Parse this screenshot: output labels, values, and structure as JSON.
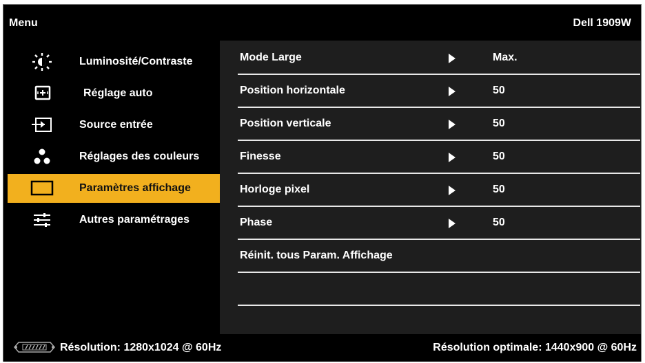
{
  "header": {
    "title": "Menu",
    "model": "Dell 1909W"
  },
  "sidebar": {
    "items": [
      {
        "label": "Luminosité/Contraste",
        "icon": "brightness-icon"
      },
      {
        "label": "Réglage auto",
        "icon": "auto-adjust-icon"
      },
      {
        "label": "Source entrée",
        "icon": "input-source-icon"
      },
      {
        "label": "Réglages des couleurs",
        "icon": "color-settings-icon"
      },
      {
        "label": "Paramètres affichage",
        "icon": "display-settings-icon",
        "selected": true
      },
      {
        "label": "Autres paramétrages",
        "icon": "other-settings-icon"
      }
    ]
  },
  "main": {
    "rows": [
      {
        "label": "Mode Large",
        "value": "Max."
      },
      {
        "label": "Position horizontale",
        "value": "50"
      },
      {
        "label": "Position verticale",
        "value": "50"
      },
      {
        "label": "Finesse",
        "value": "50"
      },
      {
        "label": "Horloge pixel",
        "value": "50"
      },
      {
        "label": "Phase",
        "value": "50"
      },
      {
        "label": "Réinit. tous Param. Affichage"
      }
    ]
  },
  "footer": {
    "resolution": "Résolution: 1280x1024 @ 60Hz",
    "optimal": "Résolution optimale: 1440x900 @ 60Hz",
    "connector_icon": "vga-connector-icon"
  },
  "colors": {
    "accent": "#f2b01e",
    "panel": "#1e1e1e",
    "background": "#000000",
    "text": "#ffffff"
  }
}
